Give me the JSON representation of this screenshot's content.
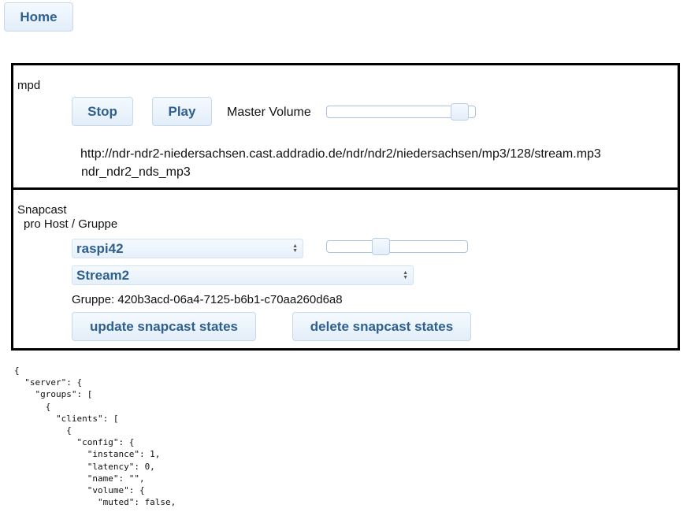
{
  "nav": {
    "home_label": "Home"
  },
  "mpd": {
    "title": "mpd",
    "stop_label": "Stop",
    "play_label": "Play",
    "volume_label": "Master Volume",
    "volume_value": 0.95,
    "stream_url": "http://ndr-ndr2-niedersachsen.cast.addradio.de/ndr/ndr2/niedersachsen/mp3/128/stream.mp3",
    "stream_name": "ndr_ndr2_nds_mp3"
  },
  "snapcast": {
    "title": "Snapcast",
    "subtitle": "pro Host / Gruppe",
    "host_selected": "raspi42",
    "host_volume_value": 0.37,
    "stream_selected": "Stream2",
    "group_text": "Gruppe: 420b3acd-06a4-7125-b6b1-c70aa260d6a8",
    "update_label": "update snapcast states",
    "delete_label": "delete snapcast states"
  },
  "json_dump": "{\n  \"server\": {\n    \"groups\": [\n      {\n        \"clients\": [\n          {\n            \"config\": {\n              \"instance\": 1,\n              \"latency\": 0,\n              \"name\": \"\",\n              \"volume\": {\n                \"muted\": false,"
}
